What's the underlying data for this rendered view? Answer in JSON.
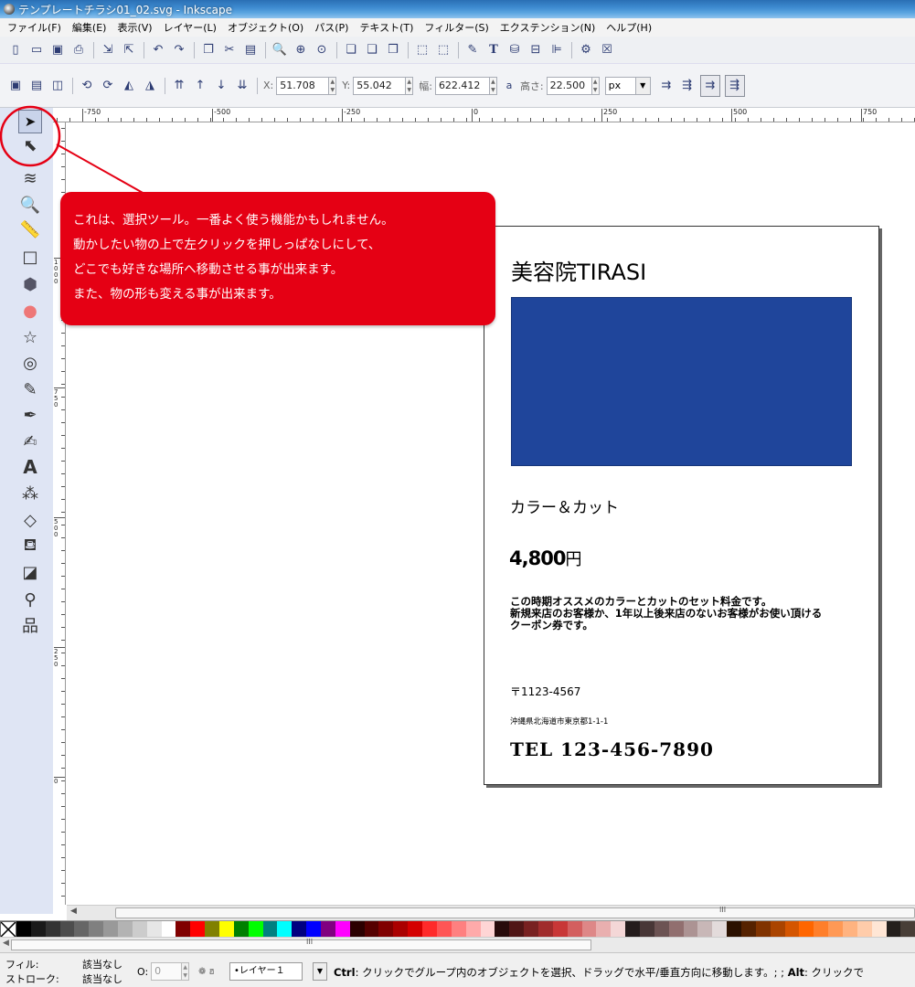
{
  "window": {
    "title": "テンプレートチラシ01_02.svg - Inkscape"
  },
  "menu": [
    "ファイル(F)",
    "編集(E)",
    "表示(V)",
    "レイヤー(L)",
    "オブジェクト(O)",
    "パス(P)",
    "テキスト(T)",
    "フィルター(S)",
    "エクステンション(N)",
    "ヘルプ(H)"
  ],
  "commands": {
    "groups": [
      [
        "new-document-icon",
        "open-icon",
        "save-icon",
        "print-icon"
      ],
      [
        "import-icon",
        "export-icon"
      ],
      [
        "undo-icon",
        "redo-icon"
      ],
      [
        "copy-icon",
        "cut-icon",
        "paste-icon"
      ],
      [
        "zoom-selection-icon",
        "zoom-drawing-icon",
        "zoom-page-icon"
      ],
      [
        "duplicate-icon",
        "clone-icon",
        "unlink-clone-icon"
      ],
      [
        "group-icon",
        "ungroup-icon"
      ],
      [
        "fill-stroke-icon",
        "text-font-icon",
        "xml-editor-icon",
        "align-icon",
        "transform-icon"
      ],
      [
        "preferences-icon",
        "document-properties-icon"
      ]
    ]
  },
  "controls": {
    "x_label": "X:",
    "x_value": "51.708",
    "y_label": "Y:",
    "y_value": "55.042",
    "w_label": "幅:",
    "w_value": "622.412",
    "lock_icon": "a",
    "h_label": "高さ:",
    "h_value": "22.500",
    "unit": "px"
  },
  "ruler": {
    "h_labels": [
      "-750",
      "-500",
      "-250",
      "0",
      "250",
      "500",
      "750"
    ],
    "v_labels": [
      "1000",
      "750",
      "500",
      "250",
      "0"
    ]
  },
  "tools": [
    "selector-tool-icon",
    "node-tool-icon",
    "tweak-tool-icon",
    "zoom-tool-icon",
    "measure-tool-icon",
    "rect-tool-icon",
    "3dbox-tool-icon",
    "ellipse-tool-icon",
    "star-tool-icon",
    "spiral-tool-icon",
    "pencil-tool-icon",
    "pen-tool-icon",
    "calligraphy-tool-icon",
    "text-tool-icon",
    "spray-tool-icon",
    "eraser-tool-icon",
    "paint-bucket-tool-icon",
    "gradient-tool-icon",
    "dropper-tool-icon",
    "connector-tool-icon"
  ],
  "callout": {
    "lines": [
      "これは、選択ツール。一番よく使う機能かもしれません。",
      "動かしたい物の上で左クリックを押しっぱなしにして、",
      "どこでも好きな場所へ移動させる事が出来ます。",
      "また、物の形も変える事が出来ます。"
    ],
    "color": "#e50014"
  },
  "flyer": {
    "title": "美容院TIRASI",
    "image_color": "#1f459b",
    "subtitle": "カラー＆カット",
    "price_number": "4,800",
    "price_unit": "円",
    "desc": [
      "この時期オススメのカラーとカットのセット料金です。",
      "新規来店のお客様か、1年以上後来店のないお客様がお使い頂ける",
      "クーポン券です。"
    ],
    "zip": "〒1123-4567",
    "address": "沖縄県北海道市東京都1-1-1",
    "tel": "TEL 123-456-7890"
  },
  "palette": [
    "#000000",
    "#1a1a1a",
    "#333333",
    "#4d4d4d",
    "#666666",
    "#808080",
    "#999999",
    "#b3b3b3",
    "#cccccc",
    "#e6e6e6",
    "#ffffff",
    "#800000",
    "#ff0000",
    "#808000",
    "#ffff00",
    "#008000",
    "#00ff00",
    "#008080",
    "#00ffff",
    "#000080",
    "#0000ff",
    "#800080",
    "#ff00ff",
    "#2b0000",
    "#550000",
    "#800000",
    "#aa0000",
    "#d40000",
    "#ff2a2a",
    "#ff5555",
    "#ff8080",
    "#ffaaaa",
    "#ffd5d5",
    "#280b0b",
    "#501616",
    "#782121",
    "#a02c2c",
    "#c83737",
    "#d35f5f",
    "#de8787",
    "#e9afaf",
    "#f4d7d7",
    "#241c1c",
    "#483737",
    "#6c5353",
    "#916f6f",
    "#ac9393",
    "#c8b7b7",
    "#e3dbdb",
    "#2b1100",
    "#552200",
    "#803300",
    "#aa4400",
    "#d45500",
    "#ff6600",
    "#ff7f2a",
    "#ff9955",
    "#ffb380",
    "#ffccaa",
    "#ffe6d5",
    "#241f1c",
    "#483e37"
  ],
  "status": {
    "fill_label": "フィル:",
    "fill_value": "該当なし",
    "stroke_label": "ストローク:",
    "stroke_value": "該当なし",
    "opacity_label": "O:",
    "opacity_value": "0",
    "layer": "•レイヤー１",
    "message_ctrl": "Ctrl",
    "message_ctrl_text": ": クリックでグループ内のオブジェクトを選択、ドラッグで水平/垂直方向に移動します。; ;",
    "message_alt": "Alt",
    "message_alt_text": ": クリックで"
  }
}
